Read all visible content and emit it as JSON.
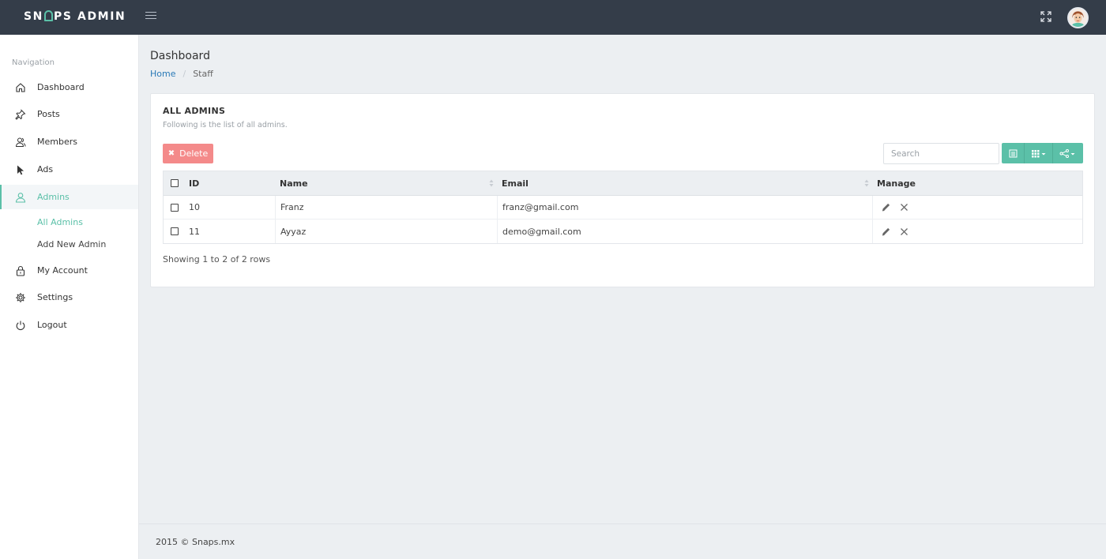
{
  "brand": {
    "text_before": "SN",
    "text_after": "PS ADMIN"
  },
  "header": {
    "menu_icon": "hamburger-icon",
    "fullscreen_icon": "expand-icon",
    "avatar_icon": "user-avatar"
  },
  "sidebar": {
    "heading": "Navigation",
    "items": [
      {
        "label": "Dashboard",
        "icon": "home-icon"
      },
      {
        "label": "Posts",
        "icon": "pin-icon"
      },
      {
        "label": "Members",
        "icon": "members-icon"
      },
      {
        "label": "Ads",
        "icon": "cursor-icon"
      },
      {
        "label": "Admins",
        "icon": "user-icon",
        "active": true
      },
      {
        "label": "My Account",
        "icon": "lock-icon"
      },
      {
        "label": "Settings",
        "icon": "gear-icon"
      },
      {
        "label": "Logout",
        "icon": "power-icon"
      }
    ],
    "sub_items": [
      {
        "label": "All Admins",
        "active": true
      },
      {
        "label": "Add New Admin"
      }
    ]
  },
  "page": {
    "title": "Dashboard",
    "breadcrumb": {
      "home": "Home",
      "current": "Staff"
    }
  },
  "card": {
    "title": "ALL ADMINS",
    "subtitle": "Following is the list of all admins.",
    "delete_label": "Delete",
    "search_placeholder": "Search"
  },
  "table": {
    "columns": {
      "id": "ID",
      "name": "Name",
      "email": "Email",
      "manage": "Manage"
    },
    "rows": [
      {
        "id": "10",
        "name": "Franz",
        "email": "franz@gmail.com"
      },
      {
        "id": "11",
        "name": "Ayyaz",
        "email": "demo@gmail.com"
      }
    ],
    "pager": "Showing 1 to 2 of 2 rows"
  },
  "footer": {
    "text": "2015 © Snaps.mx"
  },
  "colors": {
    "topbar": "#343d49",
    "accent": "#5bc0a8",
    "danger": "#f48a8a",
    "link": "#2a7ab7",
    "page_bg": "#eceff2"
  }
}
